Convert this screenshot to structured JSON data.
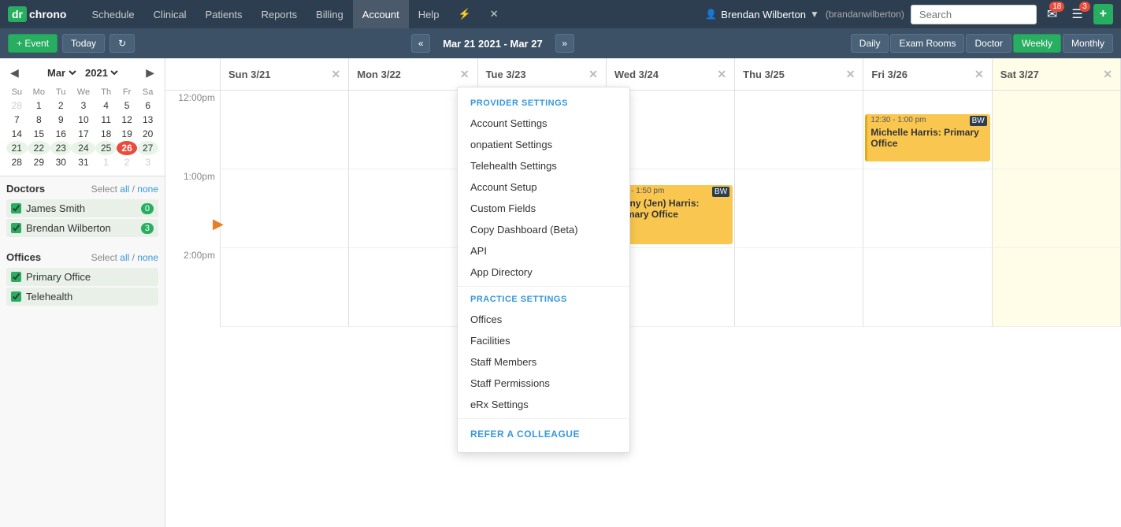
{
  "logo": {
    "icon": "dr",
    "text": "chrono"
  },
  "topNav": {
    "links": [
      {
        "id": "schedule",
        "label": "Schedule"
      },
      {
        "id": "clinical",
        "label": "Clinical"
      },
      {
        "id": "patients",
        "label": "Patients"
      },
      {
        "id": "reports",
        "label": "Reports"
      },
      {
        "id": "billing",
        "label": "Billing"
      },
      {
        "id": "account",
        "label": "Account",
        "active": true
      },
      {
        "id": "help",
        "label": "Help"
      }
    ],
    "user": {
      "name": "Brendan Wilberton",
      "fullName": "(brandanwilberton)",
      "arrow": "▼"
    },
    "search": {
      "placeholder": "Search",
      "value": ""
    },
    "notifications": {
      "mail_count": "18",
      "list_count": "3"
    }
  },
  "toolbar": {
    "event_btn": "+ Event",
    "today_btn": "Today",
    "refresh_icon": "↻",
    "date_range": "Mar 21 2021 - Mar 27",
    "views": [
      "Daily",
      "Exam Rooms",
      "Doctor",
      "Weekly",
      "Monthly"
    ],
    "active_view": "Weekly"
  },
  "miniCalendar": {
    "month": "Mar",
    "year": "2021",
    "day_headers": [
      "Su",
      "Mo",
      "Tu",
      "We",
      "Th",
      "Fr",
      "Sa"
    ],
    "weeks": [
      [
        {
          "d": "28",
          "om": true
        },
        {
          "d": "1"
        },
        {
          "d": "2"
        },
        {
          "d": "3"
        },
        {
          "d": "4"
        },
        {
          "d": "5"
        },
        {
          "d": "6"
        }
      ],
      [
        {
          "d": "7"
        },
        {
          "d": "8"
        },
        {
          "d": "9"
        },
        {
          "d": "10"
        },
        {
          "d": "11"
        },
        {
          "d": "12"
        },
        {
          "d": "13"
        }
      ],
      [
        {
          "d": "14"
        },
        {
          "d": "15"
        },
        {
          "d": "16"
        },
        {
          "d": "17"
        },
        {
          "d": "18"
        },
        {
          "d": "19"
        },
        {
          "d": "20"
        }
      ],
      [
        {
          "d": "21",
          "inrange": true
        },
        {
          "d": "22",
          "inrange": true
        },
        {
          "d": "23",
          "inrange": true
        },
        {
          "d": "24",
          "inrange": true
        },
        {
          "d": "25",
          "inrange": true
        },
        {
          "d": "26",
          "today": true
        },
        {
          "d": "27",
          "inrange": true
        }
      ],
      [
        {
          "d": "28"
        },
        {
          "d": "29"
        },
        {
          "d": "30"
        },
        {
          "d": "31"
        },
        {
          "d": "1",
          "om": true
        },
        {
          "d": "2",
          "om": true
        },
        {
          "d": "3",
          "om": true
        }
      ]
    ]
  },
  "sidebar": {
    "doctors_title": "Doctors",
    "select_all": "all",
    "select_none": "none",
    "doctors": [
      {
        "name": "James Smith",
        "count": "0",
        "checked": true
      },
      {
        "name": "Brendan Wilberton",
        "count": "3",
        "checked": true
      }
    ],
    "offices_title": "Offices",
    "offices": [
      {
        "name": "Primary Office",
        "checked": true
      },
      {
        "name": "Telehealth",
        "checked": true
      }
    ]
  },
  "calendar": {
    "headers": [
      {
        "day": "Sun 3/21",
        "weekend": false
      },
      {
        "day": "Mon 3/22",
        "weekend": false
      },
      {
        "day": "Tue 3/23",
        "weekend": false
      },
      {
        "day": "Wed 3/24",
        "weekend": false
      },
      {
        "day": "Thu 3/25",
        "weekend": false
      },
      {
        "day": "Fri 3/26",
        "weekend": false
      },
      {
        "day": "Sat 3/27",
        "weekend": true
      }
    ],
    "time_slots": [
      "12:00pm",
      "1:00pm",
      "2:00pm"
    ]
  },
  "appointments": [
    {
      "id": "appt1",
      "time": "12:30 - 1:00 pm",
      "initials": "BW",
      "name": "Michelle Harris: Primary Office",
      "day_index": 5,
      "slot_index": 0,
      "top_pct": 30,
      "height": 50
    },
    {
      "id": "appt2",
      "time": "1:20 - 1:50 pm",
      "initials": "BW",
      "name": "Jenny (Jen) Harris: Primary Office",
      "day_index": 3,
      "slot_index": 1,
      "top_pct": 20,
      "height": 70
    }
  ],
  "dropdown": {
    "visible": true,
    "provider_settings_title": "PROVIDER SETTINGS",
    "items_provider": [
      "Account Settings",
      "onpatient Settings",
      "Telehealth Settings",
      "Account Setup",
      "Custom Fields",
      "Copy Dashboard (Beta)",
      "API",
      "App Directory"
    ],
    "practice_settings_title": "PRACTICE SETTINGS",
    "items_practice": [
      "Offices",
      "Facilities",
      "Staff Members",
      "Staff Permissions",
      "eRx Settings"
    ],
    "refer_label": "REFER A COLLEAGUE"
  }
}
